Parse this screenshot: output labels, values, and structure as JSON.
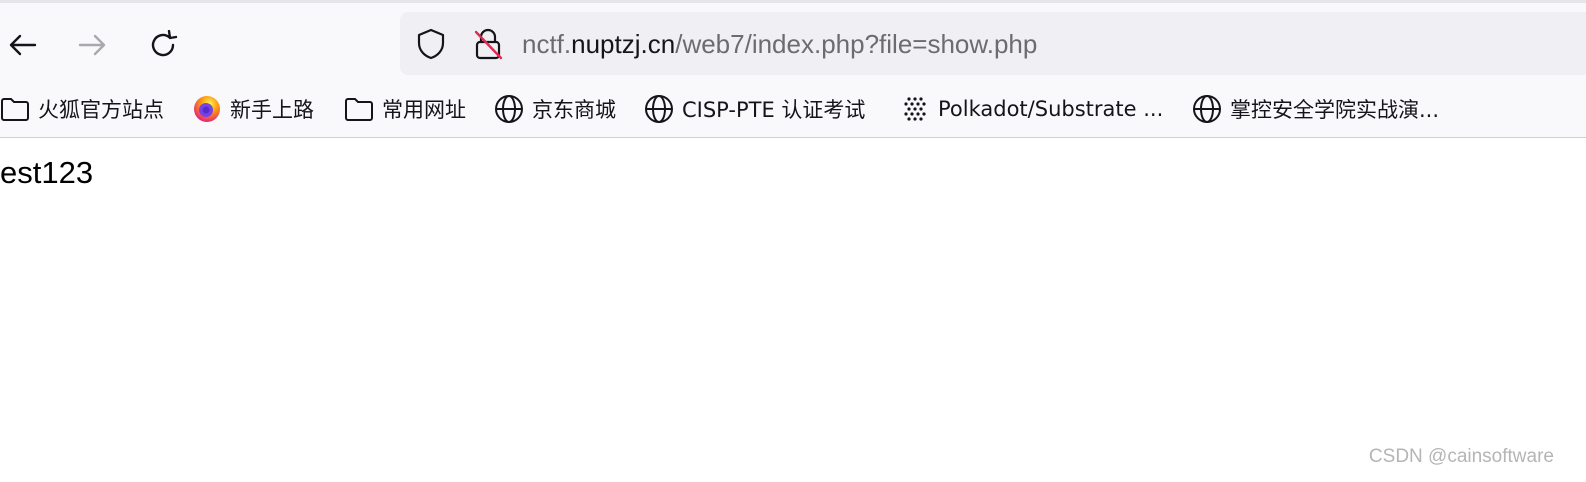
{
  "toolbar": {
    "back_icon": "back-arrow-icon",
    "forward_icon": "forward-arrow-icon",
    "reload_icon": "reload-icon"
  },
  "urlbar": {
    "url_prefix": "nctf.",
    "url_host": "nuptzj.cn",
    "url_path": "/web7/index.php?file=show.php",
    "shield_icon": "tracking-protection-shield-icon",
    "lock_icon": "insecure-lock-icon"
  },
  "bookmarks": [
    {
      "label": "火狐官方站点",
      "icon": "folder-icon"
    },
    {
      "label": "新手上路",
      "icon": "firefox-icon"
    },
    {
      "label": "常用网址",
      "icon": "folder-icon"
    },
    {
      "label": "京东商城",
      "icon": "globe-icon"
    },
    {
      "label": "CISP-PTE 认证考试",
      "icon": "globe-icon"
    },
    {
      "label": "Polkadot/Substrate ...",
      "icon": "polkadot-dots-icon"
    },
    {
      "label": "掌控安全学院实战演...",
      "icon": "globe-icon"
    }
  ],
  "content": {
    "text": "est123"
  },
  "watermark": "CSDN @cainsoftware",
  "colors": {
    "toolbar_bg": "#f9f9fb",
    "urlbar_bg": "#f0f0f4",
    "text": "#15141a",
    "url_muted": "#6b6b72",
    "insecure_strike": "#e22850"
  }
}
